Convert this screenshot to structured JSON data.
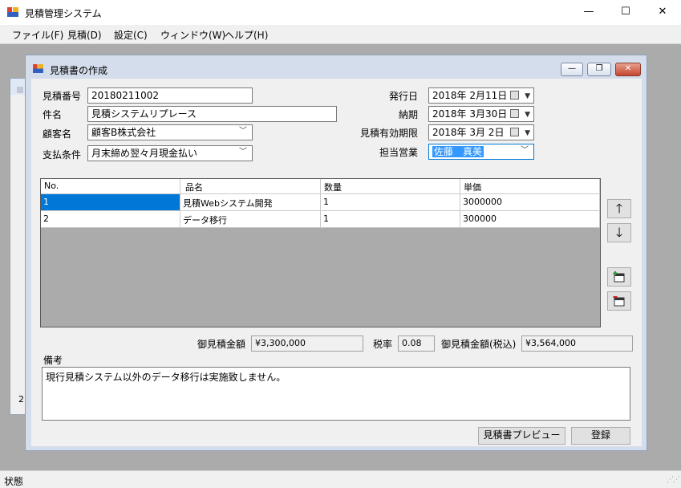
{
  "app": {
    "title": "見積管理システム",
    "window_controls": {
      "minimize": "—",
      "maximize": "☐",
      "close": "✕"
    }
  },
  "menu": [
    {
      "label": "ファイル(F)"
    },
    {
      "label": "見積(D)"
    },
    {
      "label": "設定(C)"
    },
    {
      "label": "ウィンドウ(W)"
    },
    {
      "label": "ヘルプ(H)"
    }
  ],
  "background_child": {
    "partial_text": "2"
  },
  "dialog": {
    "title": "見積書の作成",
    "controls": {
      "minimize": "—",
      "restore": "❐",
      "close": "✕"
    },
    "fields": {
      "estimate_no": {
        "label": "見積番号",
        "value": "20180211002"
      },
      "subject": {
        "label": "件名",
        "value": "見積システムリプレース"
      },
      "customer": {
        "label": "顧客名",
        "value": "顧客B株式会社"
      },
      "payment_terms": {
        "label": "支払条件",
        "value": "月末締め翌々月現金払い"
      },
      "issue_date": {
        "label": "発行日",
        "value": "2018年  2月11日"
      },
      "delivery_date": {
        "label": "納期",
        "value": "2018年  3月30日"
      },
      "valid_until": {
        "label": "見積有効期限",
        "value": "2018年  3月  2日"
      },
      "sales_rep": {
        "label": "担当営業",
        "value": "佐藤　真美"
      }
    },
    "grid": {
      "columns": [
        "No.",
        "品名",
        "数量",
        "単価"
      ],
      "rows": [
        [
          "1",
          "見積Webシステム開発",
          "1",
          "3000000"
        ],
        [
          "2",
          "データ移行",
          "1",
          "300000"
        ]
      ]
    },
    "side_buttons": {
      "up": "🡑",
      "down": "🡓",
      "add_row_icon": "add-row-icon",
      "delete_row_icon": "delete-row-icon"
    },
    "totals": {
      "amount_label": "御見積金額",
      "amount": "¥3,300,000",
      "tax_label": "税率",
      "tax": "0.08",
      "total_label": "御見積金額(税込)",
      "total": "¥3,564,000"
    },
    "notes": {
      "label": "備考",
      "value": "現行見積システム以外のデータ移行は実施致しません。"
    },
    "buttons": {
      "preview": "見積書プレビュー",
      "register": "登録"
    }
  },
  "status": {
    "text": "状態"
  },
  "colors": {
    "selection": "#0078d7",
    "grid_background": "#ababab",
    "dialog_frame": "#d4ddeb"
  }
}
